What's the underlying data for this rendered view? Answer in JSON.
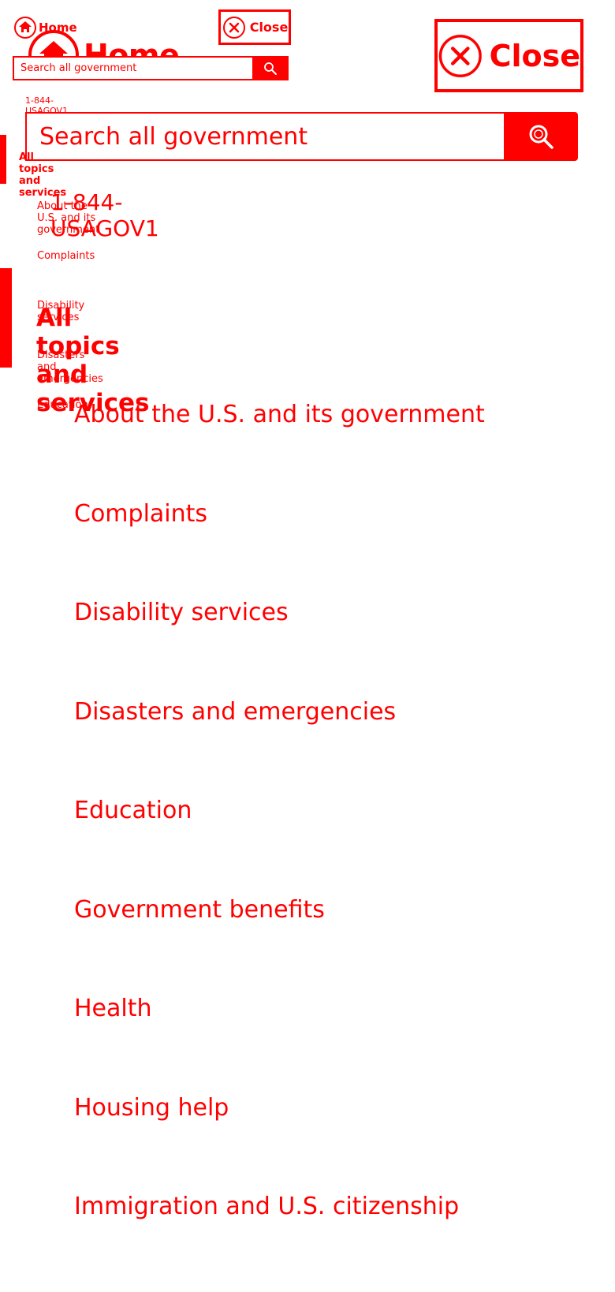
{
  "colors": {
    "accent": "#ff0000",
    "background": "#ffffff"
  },
  "header": {
    "home_label": "Home",
    "home_icon": "home-icon",
    "close_label": "Close",
    "close_icon": "close-icon"
  },
  "search": {
    "placeholder": "Search all government",
    "button_icon": "search-icon"
  },
  "phone": "1-844-USAGOV1",
  "nav": {
    "category": "All topics and services",
    "items": [
      "About the U.S. and its government",
      "Complaints",
      "Disability services",
      "Disasters and emergencies",
      "Education",
      "Government benefits",
      "Health",
      "Housing help",
      "Immigration and U.S. citizenship"
    ]
  }
}
